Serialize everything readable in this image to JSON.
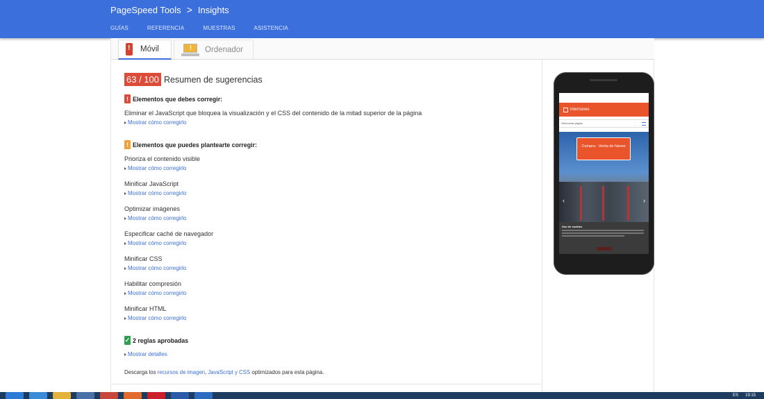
{
  "header": {
    "product": "PageSpeed Tools",
    "separator": ">",
    "section": "Insights",
    "nav": [
      "GUÍAS",
      "REFERENCIA",
      "MUESTRAS",
      "ASISTENCIA"
    ]
  },
  "tabs": {
    "mobile": "Móvil",
    "desktop": "Ordenador"
  },
  "summary": {
    "score": "63 / 100",
    "title": "Resumen de sugerencias"
  },
  "must_fix": {
    "heading": "Elementos que debes corregir:",
    "rules": [
      {
        "title": "Eliminar el JavaScript que bloquea la visualización y el CSS del contenido de la mitad superior de la página",
        "link": "Mostrar cómo corregirlo"
      }
    ]
  },
  "consider_fix": {
    "heading": "Elementos que puedes plantearte corregir:",
    "rules": [
      {
        "title": "Prioriza el contenido visible",
        "link": "Mostrar cómo corregirlo"
      },
      {
        "title": "Minificar JavaScript",
        "link": "Mostrar cómo corregirlo"
      },
      {
        "title": "Optimizar imágenes",
        "link": "Mostrar cómo corregirlo"
      },
      {
        "title": "Especificar caché de navegador",
        "link": "Mostrar cómo corregirlo"
      },
      {
        "title": "Minificar CSS",
        "link": "Mostrar cómo corregirlo"
      },
      {
        "title": "Habilitar compresión",
        "link": "Mostrar cómo corregirlo"
      },
      {
        "title": "Minificar HTML",
        "link": "Mostrar cómo corregirlo"
      }
    ]
  },
  "passed": {
    "heading": "2 reglas aprobadas",
    "link": "Mostrar detalles"
  },
  "footer": {
    "prefix": "Descarga los ",
    "link1": "recursos de imagen",
    "mid": ", ",
    "link2": "JavaScript y CSS",
    "suffix": " optimizados para esta página."
  },
  "preview": {
    "brand": "internaves",
    "select": "Seleccionar página",
    "hero_button": "Compra - Venta de Naves",
    "cookie_title": "Uso de cookies"
  },
  "taskbar": {
    "lang": "ES",
    "time": "19:15"
  },
  "colors": {
    "header_blue": "#3b6fdc",
    "score_red": "#dd4b39",
    "warn_orange": "#f1a13a",
    "pass_green": "#2e9e4f",
    "link_blue": "#3b6fdc"
  }
}
